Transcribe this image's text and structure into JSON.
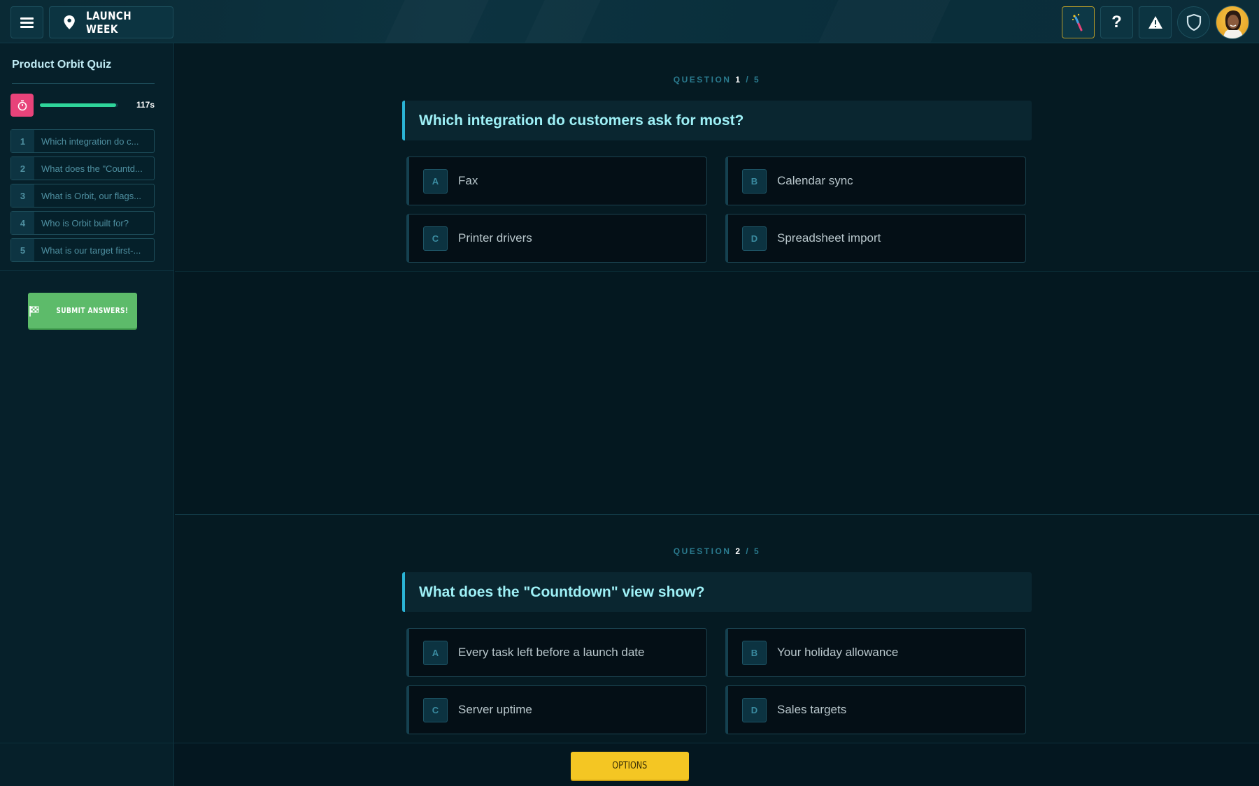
{
  "header": {
    "location_label": "LAUNCH WEEK",
    "icons": [
      "menu-icon",
      "location-pin-icon",
      "magic-wand-icon",
      "help-icon",
      "warning-icon",
      "shield-icon",
      "avatar"
    ]
  },
  "sidebar": {
    "title": "Product Orbit Quiz",
    "timer": {
      "value": "117s",
      "progress": 0.97
    },
    "questions": [
      {
        "num": "1",
        "text": "Which integration do c..."
      },
      {
        "num": "2",
        "text": "What does the \"Countd..."
      },
      {
        "num": "3",
        "text": "What is Orbit, our flags..."
      },
      {
        "num": "4",
        "text": "Who is Orbit built for?"
      },
      {
        "num": "5",
        "text": "What is our target first-..."
      }
    ],
    "submit_label": "SUBMIT ANSWERS!"
  },
  "main": {
    "q1": {
      "counter_label": "QUESTION",
      "counter_current": "1",
      "counter_total": "/ 5",
      "title": "Which integration do customers ask for most?",
      "answers": [
        {
          "letter": "A",
          "text": "Fax"
        },
        {
          "letter": "B",
          "text": "Calendar sync"
        },
        {
          "letter": "C",
          "text": "Printer drivers"
        },
        {
          "letter": "D",
          "text": "Spreadsheet import"
        }
      ]
    },
    "q2": {
      "counter_label": "QUESTION",
      "counter_current": "2",
      "counter_total": "/ 5",
      "title": "What does the \"Countdown\" view show?",
      "answers": [
        {
          "letter": "A",
          "text": "Every task left before a launch date"
        },
        {
          "letter": "B",
          "text": "Your holiday allowance"
        },
        {
          "letter": "C",
          "text": "Server uptime"
        },
        {
          "letter": "D",
          "text": "Sales targets"
        }
      ]
    }
  },
  "footer": {
    "options_label": "OPTIONS"
  },
  "colors": {
    "accent": "#2bb4d6",
    "question_text": "#9ef0f6",
    "timer_bar": "#2fd49a",
    "timer_icon": "#e8437a",
    "submit": "#5dbb6a",
    "options": "#f4c623"
  }
}
